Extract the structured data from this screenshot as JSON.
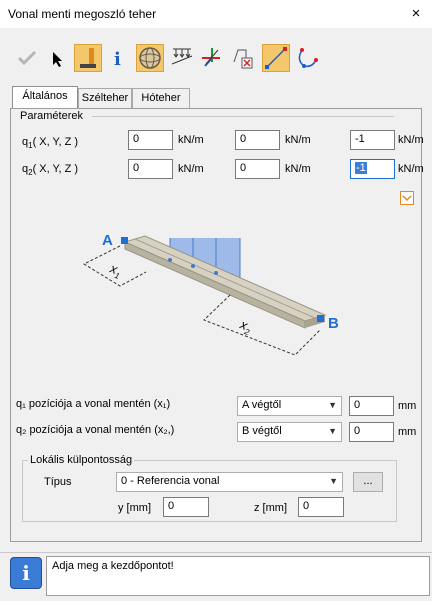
{
  "window": {
    "title": "Vonal menti megoszló teher",
    "close_icon": "×"
  },
  "toolbar": {
    "items": [
      {
        "name": "check-icon",
        "active": false
      },
      {
        "name": "pointer-icon",
        "active": false
      },
      {
        "name": "beam-load-icon",
        "active": true
      },
      {
        "name": "info-icon",
        "active": false
      },
      {
        "name": "sphere-icon",
        "active": true
      },
      {
        "name": "load-distribution-icon",
        "active": false
      },
      {
        "name": "axis-icon",
        "active": false
      },
      {
        "name": "remove-icon",
        "active": false
      },
      {
        "name": "line-tool-icon",
        "active": true
      },
      {
        "name": "curve-tool-icon",
        "active": false
      }
    ]
  },
  "tabs": [
    {
      "label": "Általános",
      "active": true
    },
    {
      "label": "Szélteher",
      "active": false
    },
    {
      "label": "Hóteher",
      "active": false
    }
  ],
  "parameters": {
    "legend": "Paraméterek",
    "q1": {
      "label_main": "q",
      "label_sub": "1",
      "label_rest": "( X, Y, Z )",
      "values": [
        "0",
        "0",
        "-1"
      ],
      "unit": "kN/m"
    },
    "q2": {
      "label_main": "q",
      "label_sub": "2",
      "label_rest": "( X, Y, Z )",
      "values": [
        "0",
        "0",
        "-1"
      ],
      "unit": "kN/m"
    }
  },
  "diagram": {
    "point_a": "A",
    "point_b": "B",
    "x1_main": "x",
    "x1_sub": "1",
    "x2_main": "x",
    "x2_sub": "2"
  },
  "positions": {
    "q1": {
      "label": "q₁ pozíciója a vonal mentén (x₁)",
      "select": "A végtől",
      "value": "0",
      "unit": "mm"
    },
    "q2": {
      "label": "q₂ pozíciója a vonal mentén (x₂,)",
      "select": "B végtől",
      "value": "0",
      "unit": "mm"
    }
  },
  "eccentricity": {
    "legend": "Lokális külpontosság",
    "type_label": "Típus",
    "type_value": "0 - Referencia vonal",
    "more_button": "...",
    "y_label": "y [mm]",
    "y_value": "0",
    "z_label": "z [mm]",
    "z_value": "0"
  },
  "status": {
    "message": "Adja meg a kezdőpontot!",
    "icon": "i"
  },
  "colors": {
    "accent": "#f5c76c",
    "blue": "#1e6fd9",
    "selection": "#3d7fd6"
  }
}
